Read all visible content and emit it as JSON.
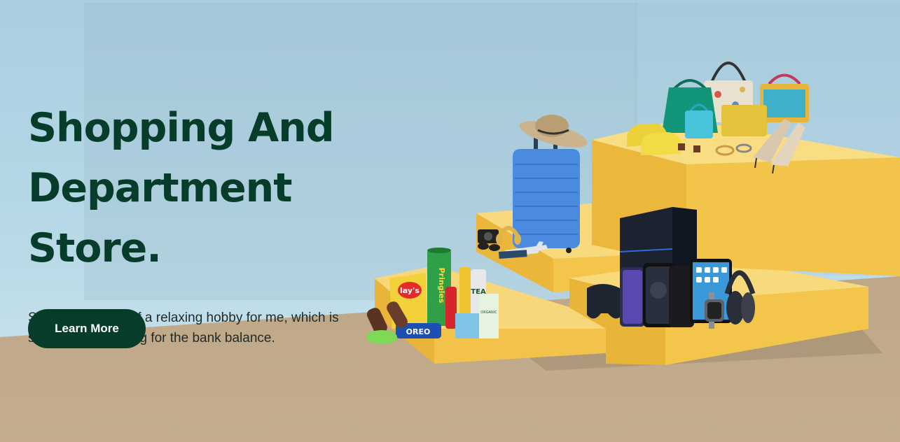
{
  "hero": {
    "title_line1": "Shopping And",
    "title_line2": "Department Store.",
    "description": "Shopping is a bit of a relaxing hobby for me, which is sometimes troubling for the bank balance.",
    "cta_label": "Learn More"
  },
  "products": {
    "chips_brand": "lay's",
    "can_brand": "Pringles",
    "cookie_brand": "OREO",
    "drink_label": "TEA",
    "box_label": "ORGANIC"
  },
  "colors": {
    "brand_green": "#063d2a",
    "platform_yellow": "#f2c84b",
    "sky": "#a9cfe0",
    "floor": "#bfae8e"
  },
  "icons": [
    "suitcase-icon",
    "sun-hat-icon",
    "handbag-icon",
    "sneaker-icon",
    "high-heel-icon",
    "game-console-icon",
    "smartphone-icon",
    "tablet-icon",
    "headphones-icon",
    "smartwatch-icon",
    "controller-icon",
    "camera-icon",
    "snack-icon",
    "ice-cream-icon"
  ]
}
